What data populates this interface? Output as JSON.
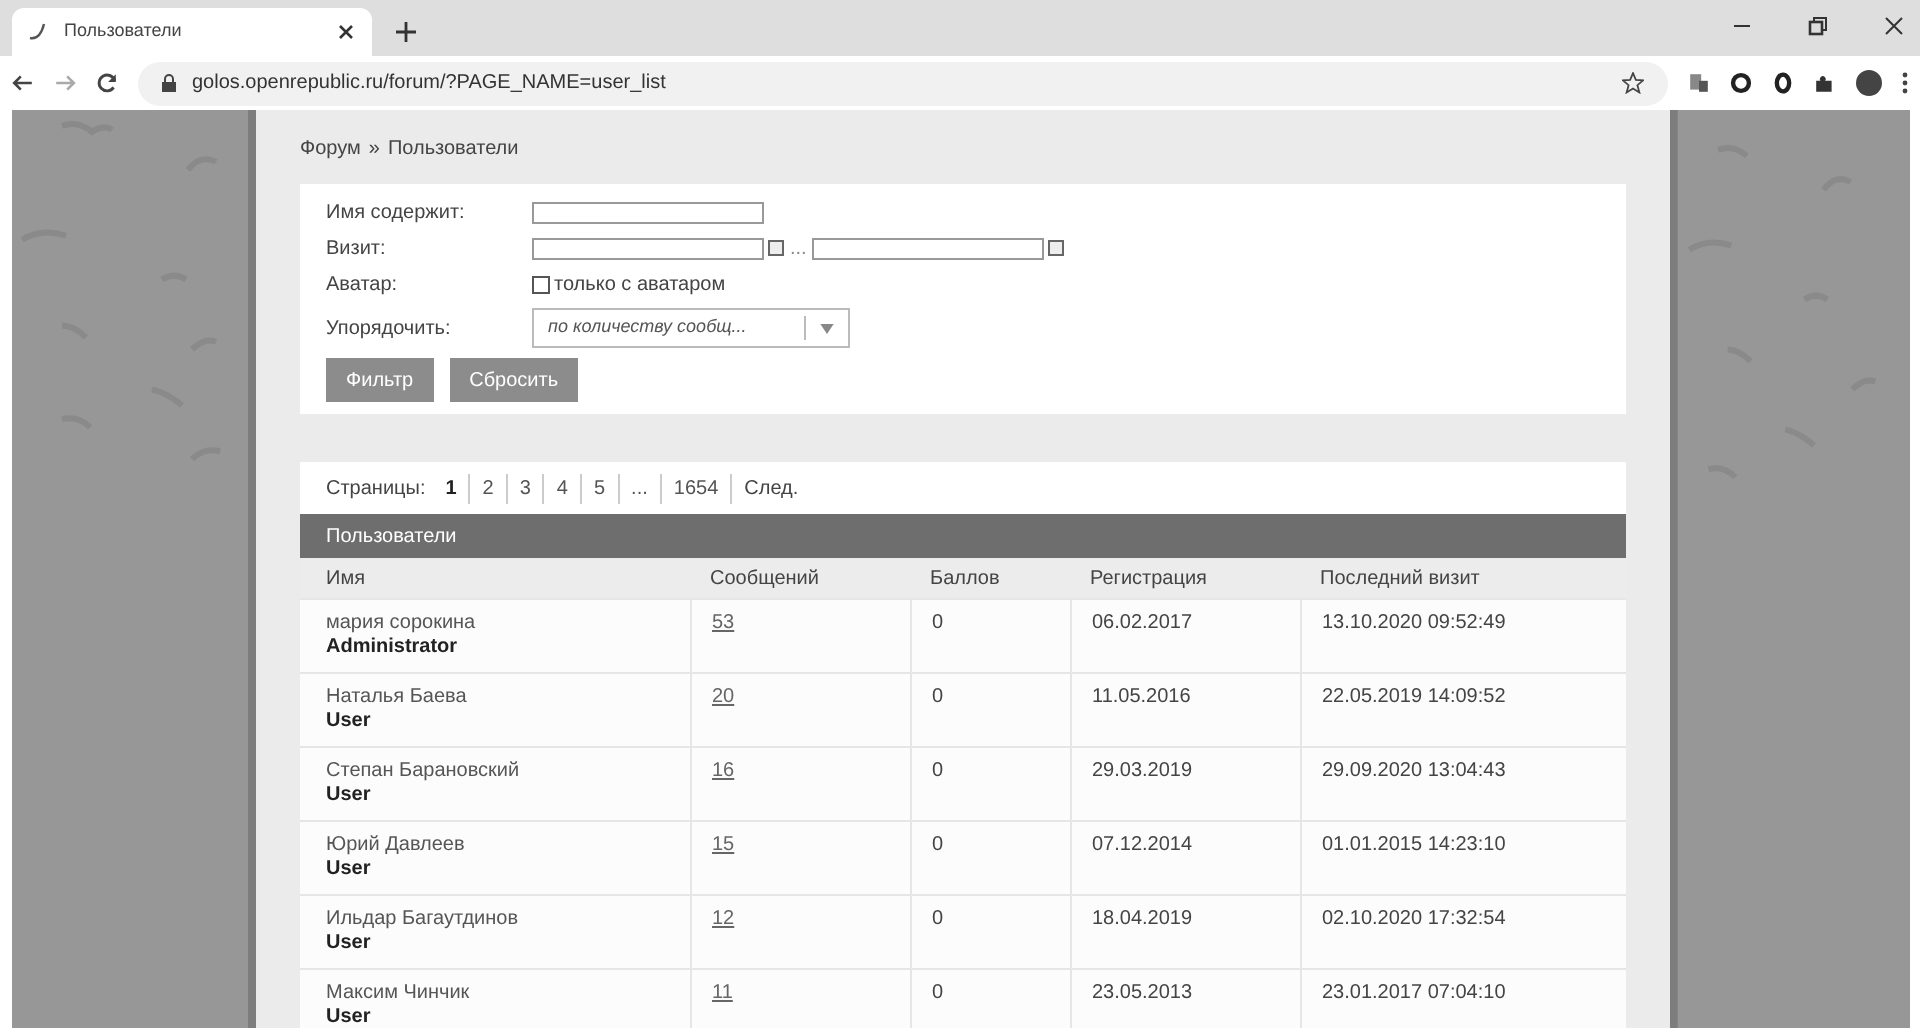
{
  "browser": {
    "tab_title": "Пользователи",
    "url": "golos.openrepublic.ru/forum/?PAGE_NAME=user_list"
  },
  "breadcrumb": {
    "parent": "Форум",
    "separator": "»",
    "current": "Пользователи"
  },
  "filter": {
    "name_label": "Имя содержит:",
    "visit_label": "Визит:",
    "visit_separator": "...",
    "avatar_label": "Аватар:",
    "avatar_option": {
      "label": "только с аватаром",
      "checked": false
    },
    "sort_label": "Упорядочить:",
    "sort_value": "по количеству сообщ...",
    "buttons": [
      "Фильтр",
      "Сбросить"
    ]
  },
  "pager": {
    "label": "Страницы:",
    "pages": [
      {
        "label": "1",
        "selected": true
      },
      {
        "label": "2",
        "selected": false
      },
      {
        "label": "3",
        "selected": false
      },
      {
        "label": "4",
        "selected": false
      },
      {
        "label": "5",
        "selected": false
      },
      {
        "label": "...",
        "selected": false
      },
      {
        "label": "1654",
        "selected": false
      }
    ],
    "next": "След."
  },
  "table": {
    "title": "Пользователи",
    "columns": [
      "Имя",
      "Сообщений",
      "Баллов",
      "Регистрация",
      "Последний визит"
    ],
    "rows": [
      {
        "name": "мария сорокина",
        "role": "Administrator",
        "messages": "53",
        "points": "0",
        "registered": "06.02.2017",
        "last_visit": "13.10.2020 09:52:49"
      },
      {
        "name": "Наталья Баева",
        "role": "User",
        "messages": "20",
        "points": "0",
        "registered": "11.05.2016",
        "last_visit": "22.05.2019 14:09:52"
      },
      {
        "name": "Степан Барановский",
        "role": "User",
        "messages": "16",
        "points": "0",
        "registered": "29.03.2019",
        "last_visit": "29.09.2020 13:04:43"
      },
      {
        "name": "Юрий Давлеев",
        "role": "User",
        "messages": "15",
        "points": "0",
        "registered": "07.12.2014",
        "last_visit": "01.01.2015 14:23:10"
      },
      {
        "name": "Ильдар Багаутдинов",
        "role": "User",
        "messages": "12",
        "points": "0",
        "registered": "18.04.2019",
        "last_visit": "02.10.2020 17:32:54"
      },
      {
        "name": "Максим Чинчик",
        "role": "User",
        "messages": "11",
        "points": "0",
        "registered": "23.05.2013",
        "last_visit": "23.01.2017 07:04:10"
      }
    ]
  }
}
